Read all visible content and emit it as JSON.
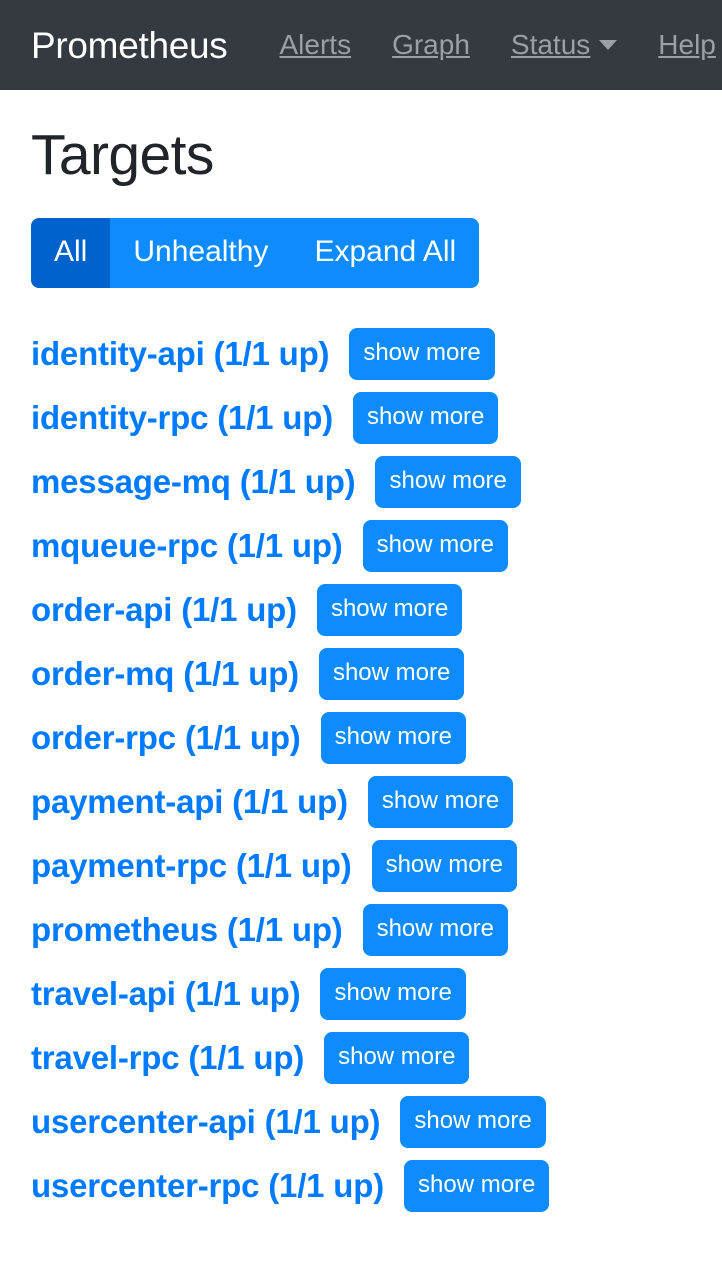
{
  "navbar": {
    "brand": "Prometheus",
    "links": [
      {
        "label": "Alerts",
        "has_caret": false
      },
      {
        "label": "Graph",
        "has_caret": false
      },
      {
        "label": "Status",
        "has_caret": true
      },
      {
        "label": "Help",
        "has_caret": false
      }
    ]
  },
  "page": {
    "title": "Targets"
  },
  "filters": {
    "all_label": "All",
    "unhealthy_label": "Unhealthy",
    "expand_all_label": "Expand All",
    "active": "All"
  },
  "show_more_label": "show more",
  "targets": [
    {
      "name": "identity-api",
      "status": "(1/1 up)",
      "label": "identity-api (1/1 up)"
    },
    {
      "name": "identity-rpc",
      "status": "(1/1 up)",
      "label": "identity-rpc (1/1 up)"
    },
    {
      "name": "message-mq",
      "status": "(1/1 up)",
      "label": "message-mq (1/1 up)"
    },
    {
      "name": "mqueue-rpc",
      "status": "(1/1 up)",
      "label": "mqueue-rpc (1/1 up)"
    },
    {
      "name": "order-api",
      "status": "(1/1 up)",
      "label": "order-api (1/1 up)"
    },
    {
      "name": "order-mq",
      "status": "(1/1 up)",
      "label": "order-mq (1/1 up)"
    },
    {
      "name": "order-rpc",
      "status": "(1/1 up)",
      "label": "order-rpc (1/1 up)"
    },
    {
      "name": "payment-api",
      "status": "(1/1 up)",
      "label": "payment-api (1/1 up)"
    },
    {
      "name": "payment-rpc",
      "status": "(1/1 up)",
      "label": "payment-rpc (1/1 up)"
    },
    {
      "name": "prometheus",
      "status": "(1/1 up)",
      "label": "prometheus (1/1 up)"
    },
    {
      "name": "travel-api",
      "status": "(1/1 up)",
      "label": "travel-api (1/1 up)"
    },
    {
      "name": "travel-rpc",
      "status": "(1/1 up)",
      "label": "travel-rpc (1/1 up)"
    },
    {
      "name": "usercenter-api",
      "status": "(1/1 up)",
      "label": "usercenter-api (1/1 up)"
    },
    {
      "name": "usercenter-rpc",
      "status": "(1/1 up)",
      "label": "usercenter-rpc (1/1 up)"
    }
  ],
  "colors": {
    "navbar_bg": "#343a40",
    "nav_link": "#9aa0a6",
    "primary_blue": "#007bff",
    "button_blue": "#0d8bff",
    "button_active_blue": "#0062cc",
    "title_text": "#212529",
    "page_bg": "#ffffff"
  }
}
